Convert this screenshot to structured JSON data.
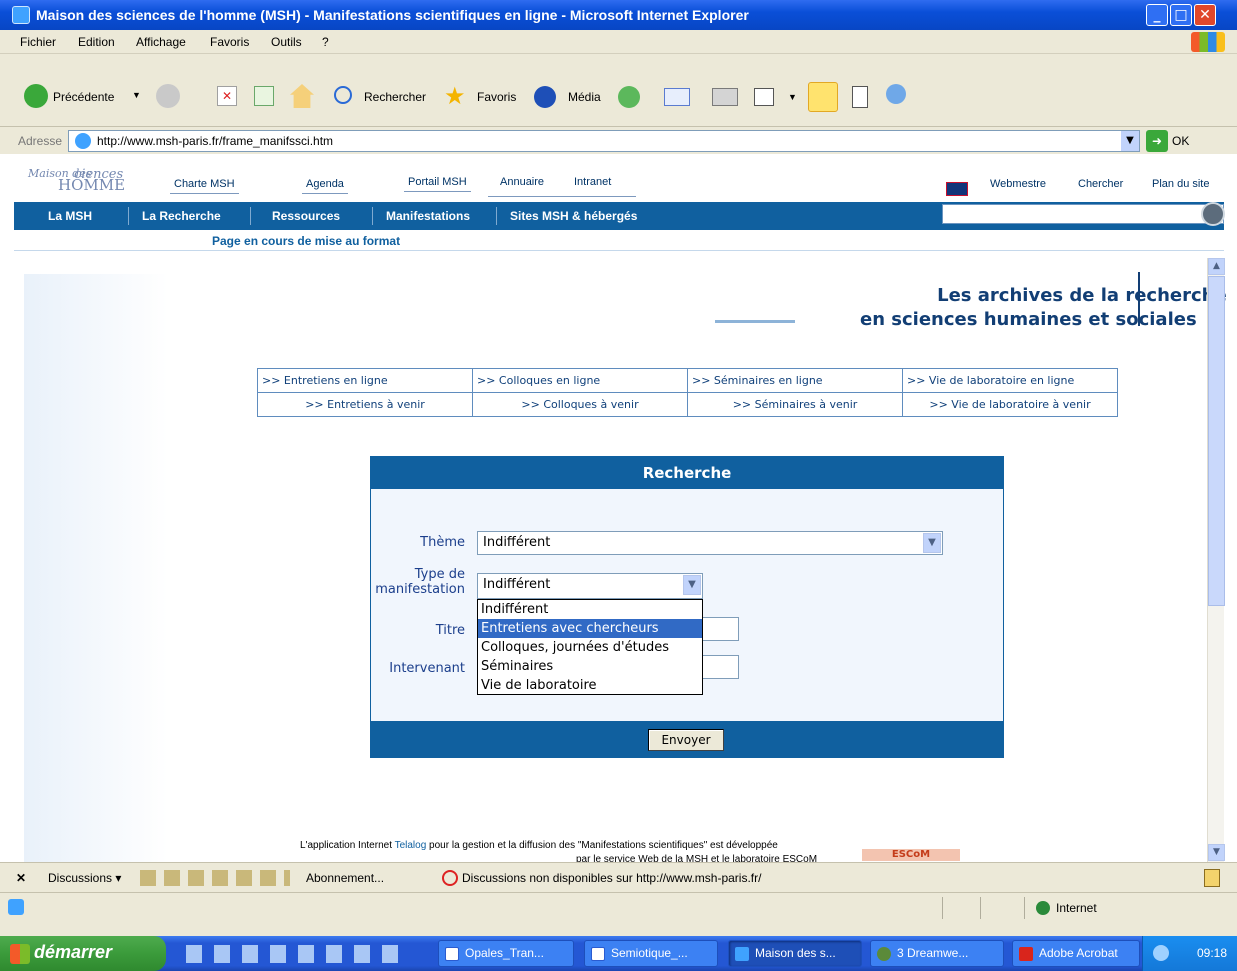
{
  "window": {
    "title": "Maison des sciences de l'homme (MSH) - Manifestations scientifiques en ligne - Microsoft Internet Explorer"
  },
  "menu": [
    "Fichier",
    "Edition",
    "Affichage",
    "Favoris",
    "Outils",
    "?"
  ],
  "toolbar": {
    "back": "Précédente",
    "search": "Rechercher",
    "favorites": "Favoris",
    "media": "Média"
  },
  "address": {
    "label": "Adresse",
    "url": "http://www.msh-paris.fr/frame_manifssci.htm",
    "go": "OK"
  },
  "site": {
    "logo_line1": "Maison des",
    "logo_line2": "ciences",
    "logo_line3": "HOMME",
    "top_links": [
      "Charte MSH",
      "Agenda",
      "Portail MSH",
      "Annuaire",
      "Intranet"
    ],
    "right_links": [
      "Webmestre",
      "Chercher",
      "Plan du site"
    ],
    "nav": [
      "La MSH",
      "La Recherche",
      "Ressources",
      "Manifestations",
      "Sites MSH & hébergés"
    ],
    "page_note": "Page en cours de mise au format",
    "archive_line1": "Les archives de la recherche",
    "archive_line2": "en sciences humaines et sociales",
    "links_row1": [
      ">> Entretiens en ligne",
      ">> Colloques en ligne",
      ">> Séminaires en ligne",
      ">> Vie de laboratoire en ligne"
    ],
    "links_row2": [
      ">> Entretiens à venir",
      ">> Colloques à venir",
      ">> Séminaires à venir",
      ">> Vie de laboratoire à venir"
    ]
  },
  "search": {
    "title": "Recherche",
    "theme_label": "Thème",
    "theme_value": "Indifférent",
    "type_label_1": "Type de",
    "type_label_2": "manifestation",
    "type_value": "Indifférent",
    "title_label": "Titre",
    "speaker_label": "Intervenant",
    "options": [
      "Indifférent",
      "Entretiens avec chercheurs",
      "Colloques, journées d'études",
      "Séminaires",
      "Vie de laboratoire"
    ],
    "highlighted_option": "Entretiens avec chercheurs",
    "submit": "Envoyer"
  },
  "footer": {
    "pre": "L'application Internet ",
    "link": "Telalog",
    "post": " pour la gestion et la diffusion des \"Manifestations scientifiques\" est développée",
    "line2": "par le service Web de la MSH et le laboratoire ESCoM",
    "logo": "ESCoM"
  },
  "discussions": {
    "label": "Discussions ▾",
    "subscribe": "Abonnement...",
    "message": "Discussions non disponibles sur http://www.msh-paris.fr/"
  },
  "status": {
    "zone": "Internet"
  },
  "taskbar": {
    "start": "démarrer",
    "tasks": [
      "Opales_Tran...",
      "Semiotique_...",
      "Maison des s...",
      "3 Dreamwe...",
      "Adobe Acrobat"
    ],
    "clock": "09:18"
  }
}
